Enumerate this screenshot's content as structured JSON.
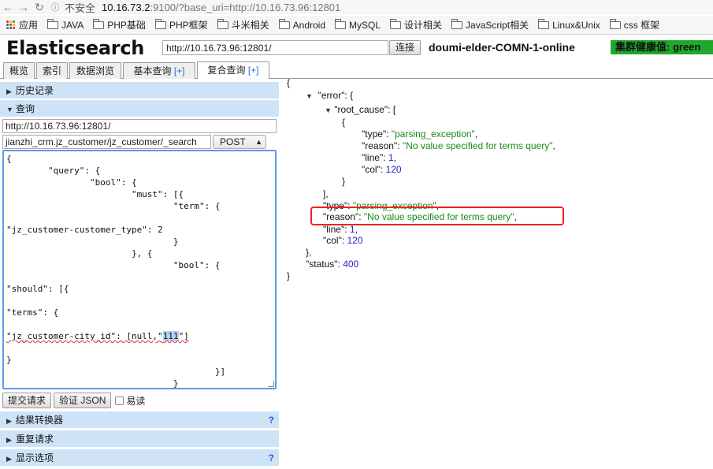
{
  "browser": {
    "security_label": "不安全",
    "url_host": "10.16.73.2",
    "url_rest": ":9100/?base_uri=http://10.16.73.96:12801",
    "bookmarks": [
      "应用",
      "JAVA",
      "PHP基础",
      "PHP框架",
      "斗米相关",
      "Android",
      "MySQL",
      "设计相关",
      "JavaScript相关",
      "Linux&Unix",
      "css 框架"
    ]
  },
  "header": {
    "title": "Elasticsearch",
    "url_value": "http://10.16.73.96:12801/",
    "connect_label": "连接",
    "cluster_name": "doumi-elder-COMN-1-online",
    "health_text": "集群健康值: green"
  },
  "tabs": [
    {
      "label": "概览",
      "plus": ""
    },
    {
      "label": "索引",
      "plus": ""
    },
    {
      "label": "数据浏览",
      "plus": ""
    },
    {
      "label": "基本查询",
      "plus": "[+]"
    },
    {
      "label": "复合查询",
      "plus": "[+]"
    }
  ],
  "left": {
    "history_label": "历史记录",
    "query_label": "查询",
    "query_url": "http://10.16.73.96:12801/",
    "query_path": "jianzhi_crm.jz_customer/jz_customer/_search",
    "method": "POST",
    "body_lines": [
      "{",
      "        \"query\": {",
      "                \"bool\": {",
      "                        \"must\": [{",
      "                                \"term\": {",
      "",
      "\"jz_customer-customer_type\": 2",
      "                                }",
      "                        }, {",
      "                                \"bool\": {",
      "",
      "\"should\": [{",
      "",
      "\"terms\": {",
      "",
      "\"jz_customer-city_id\": [null,\"111\"]",
      "",
      "}",
      "                                        }]",
      "                                }"
    ],
    "submit_label": "提交请求",
    "validate_label": "验证 JSON",
    "pretty_label": "易读",
    "transformer_label": "结果转换器",
    "repeat_label": "重复请求",
    "display_label": "显示选项",
    "help_mark": "?"
  },
  "response": {
    "open_brace": "{",
    "error_key": "\"error\": {",
    "root_cause_key": "\"root_cause\": [",
    "inner_open": "{",
    "type_key": "\"type\": ",
    "type_value": "\"parsing_exception\"",
    "reason_key": "\"reason\": ",
    "reason_value": "\"No value specified for terms query\"",
    "line_key": "\"line\": ",
    "line_value": "1",
    "col_key": "\"col\": ",
    "col_value": "120",
    "inner_close": "}",
    "array_close": "],",
    "error_close": "},",
    "status_key": "\"status\": ",
    "status_value": "400",
    "close_brace": "}"
  },
  "colors": {
    "health_green": "#1fa82b",
    "section_blue": "#cfe3f7",
    "string_green": "#1a8a1a",
    "number_blue": "#2222cc",
    "annotation_red": "#e22222"
  }
}
